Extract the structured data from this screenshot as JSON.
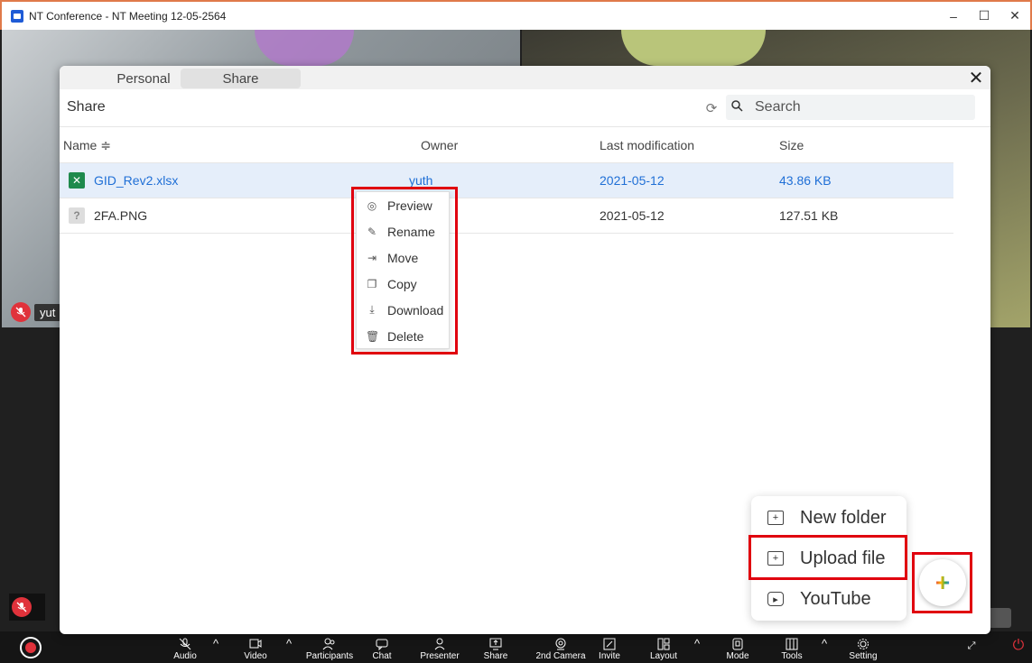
{
  "window": {
    "title": "NT Conference - NT Meeting 12-05-2564",
    "minimize": "–",
    "maximize": "☐",
    "close": "✕"
  },
  "video": {
    "participant_name": "yut"
  },
  "modal": {
    "tabs": [
      "Personal",
      "Share"
    ],
    "active_tab": "Share",
    "close": "✕",
    "section_title": "Share",
    "search_placeholder": "Search",
    "columns": {
      "name": "Name ≑",
      "owner": "Owner",
      "modified": "Last modification",
      "size": "Size"
    },
    "files": [
      {
        "name": "GID_Rev2.xlsx",
        "owner": "yuth",
        "modified": "2021-05-12",
        "size": "43.86 KB",
        "type": "xlsx"
      },
      {
        "name": "2FA.PNG",
        "owner": "",
        "modified": "2021-05-12",
        "size": "127.51 KB",
        "type": "unknown"
      }
    ],
    "context_menu": [
      {
        "label": "Preview",
        "icon": "eye-icon"
      },
      {
        "label": "Rename",
        "icon": "pencil-icon"
      },
      {
        "label": "Move",
        "icon": "move-icon"
      },
      {
        "label": "Copy",
        "icon": "copy-icon"
      },
      {
        "label": "Download",
        "icon": "download-icon"
      },
      {
        "label": "Delete",
        "icon": "trash-icon"
      }
    ],
    "add_menu": [
      {
        "label": "New folder",
        "icon": "new-folder-icon"
      },
      {
        "label": "Upload file",
        "icon": "upload-file-icon"
      },
      {
        "label": "YouTube",
        "icon": "youtube-icon"
      }
    ],
    "fab": "+"
  },
  "toolbar": {
    "items": [
      "Audio",
      "Video",
      "Participants",
      "Chat",
      "Presenter",
      "Share",
      "2nd Camera",
      "Invite",
      "Layout",
      "Mode",
      "Tools",
      "Setting"
    ]
  },
  "colors": {
    "highlight": "#e0000e",
    "selected_row": "#e5eefa",
    "link_blue": "#1f6fd6",
    "mic_off": "#e0323b"
  }
}
